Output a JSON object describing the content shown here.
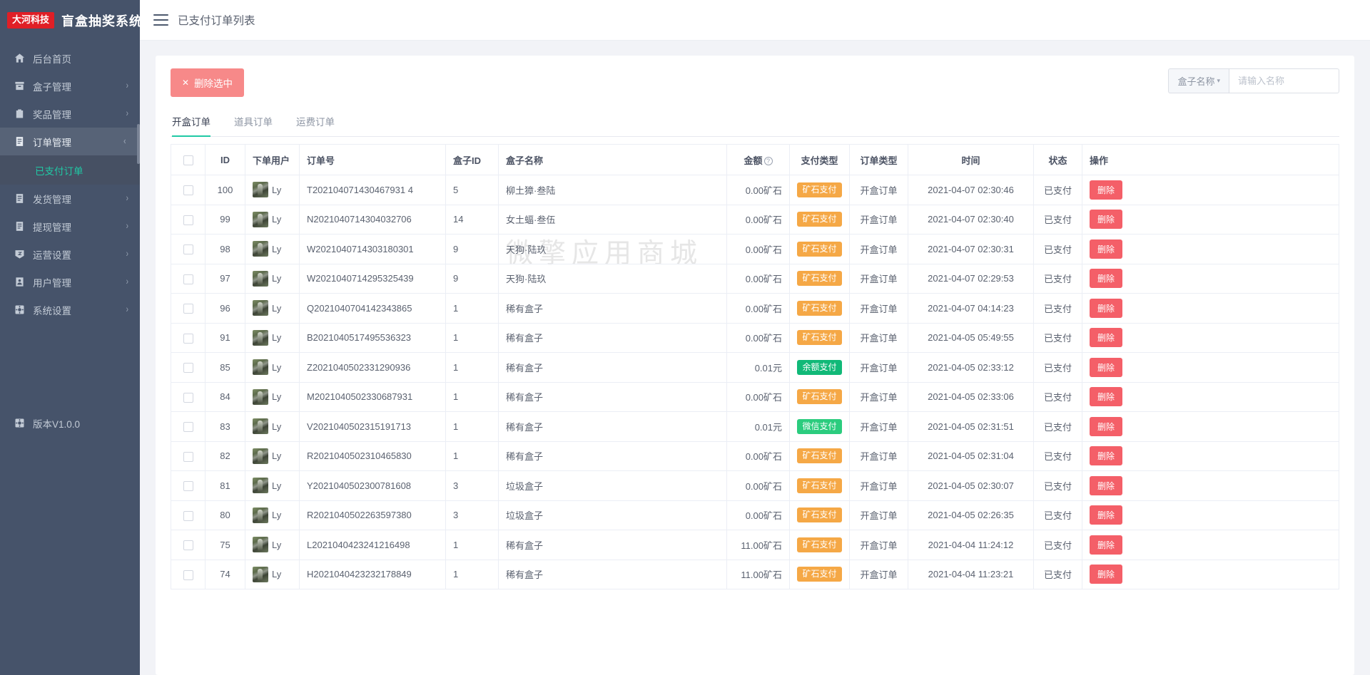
{
  "brand": {
    "logo_text": "大河科技",
    "title": "盲盒抽奖系统"
  },
  "sidebar": {
    "items": [
      {
        "label": "后台首页",
        "icon": "home-icon",
        "arrow": ""
      },
      {
        "label": "盒子管理",
        "icon": "box-icon",
        "arrow": "›"
      },
      {
        "label": "奖品管理",
        "icon": "gift-icon",
        "arrow": "›"
      },
      {
        "label": "订单管理",
        "icon": "order-icon",
        "arrow": "⌄",
        "expanded": true
      },
      {
        "label": "发货管理",
        "icon": "ship-icon",
        "arrow": "›"
      },
      {
        "label": "提现管理",
        "icon": "cash-icon",
        "arrow": "›"
      },
      {
        "label": "运营设置",
        "icon": "ops-icon",
        "arrow": "›"
      },
      {
        "label": "用户管理",
        "icon": "user-icon",
        "arrow": "›"
      },
      {
        "label": "系统设置",
        "icon": "gear-icon",
        "arrow": "›"
      }
    ],
    "submenu": [
      {
        "label": "已支付订单",
        "active": true
      }
    ],
    "version": {
      "label": "版本V1.0.0",
      "icon": "version-icon"
    }
  },
  "topbar": {
    "title": "已支付订单列表",
    "menu_icon": "hamburger-icon"
  },
  "toolbar": {
    "delete_selected_label": "删除选中",
    "delete_selected_icon": "close-x-icon",
    "search_prefix_label": "盒子名称",
    "search_prefix_caret": "▾",
    "search_placeholder": "请输入名称",
    "search_value": ""
  },
  "tabs": [
    {
      "label": "开盒订单",
      "active": true
    },
    {
      "label": "道具订单",
      "active": false
    },
    {
      "label": "运费订单",
      "active": false
    }
  ],
  "watermark": "微擎应用商城",
  "table": {
    "columns": [
      {
        "key": "checkbox",
        "label": ""
      },
      {
        "key": "id",
        "label": "ID"
      },
      {
        "key": "user",
        "label": "下单用户"
      },
      {
        "key": "order_no",
        "label": "订单号"
      },
      {
        "key": "box_id",
        "label": "盒子ID"
      },
      {
        "key": "box_name",
        "label": "盒子名称"
      },
      {
        "key": "amount",
        "label": "金额",
        "has_help_icon": true,
        "help_glyph": "?"
      },
      {
        "key": "pay_type",
        "label": "支付类型"
      },
      {
        "key": "order_type",
        "label": "订单类型"
      },
      {
        "key": "time",
        "label": "时间"
      },
      {
        "key": "status",
        "label": "状态"
      },
      {
        "key": "action",
        "label": "操作"
      }
    ],
    "action_label": "删除",
    "rows": [
      {
        "id": "100",
        "user": "Ly",
        "order_no": "T202104071430467931 4",
        "box_id": "5",
        "box_name": "柳土獐·叁陆",
        "amount": "0.00矿石",
        "pay_type": "矿石支付",
        "pay_class": "ore",
        "order_type": "开盒订单",
        "time": "2021-04-07 02:30:46",
        "status": "已支付"
      },
      {
        "id": "99",
        "user": "Ly",
        "order_no": "N2021040714304032706",
        "box_id": "14",
        "box_name": "女土蝠·叁伍",
        "amount": "0.00矿石",
        "pay_type": "矿石支付",
        "pay_class": "ore",
        "order_type": "开盒订单",
        "time": "2021-04-07 02:30:40",
        "status": "已支付"
      },
      {
        "id": "98",
        "user": "Ly",
        "order_no": "W2021040714303180301",
        "box_id": "9",
        "box_name": "天狗·陆玖",
        "amount": "0.00矿石",
        "pay_type": "矿石支付",
        "pay_class": "ore",
        "order_type": "开盒订单",
        "time": "2021-04-07 02:30:31",
        "status": "已支付"
      },
      {
        "id": "97",
        "user": "Ly",
        "order_no": "W2021040714295325439",
        "box_id": "9",
        "box_name": "天狗·陆玖",
        "amount": "0.00矿石",
        "pay_type": "矿石支付",
        "pay_class": "ore",
        "order_type": "开盒订单",
        "time": "2021-04-07 02:29:53",
        "status": "已支付"
      },
      {
        "id": "96",
        "user": "Ly",
        "order_no": "Q2021040704142343865",
        "box_id": "1",
        "box_name": "稀有盒子",
        "amount": "0.00矿石",
        "pay_type": "矿石支付",
        "pay_class": "ore",
        "order_type": "开盒订单",
        "time": "2021-04-07 04:14:23",
        "status": "已支付"
      },
      {
        "id": "91",
        "user": "Ly",
        "order_no": "B2021040517495536323",
        "box_id": "1",
        "box_name": "稀有盒子",
        "amount": "0.00矿石",
        "pay_type": "矿石支付",
        "pay_class": "ore",
        "order_type": "开盒订单",
        "time": "2021-04-05 05:49:55",
        "status": "已支付"
      },
      {
        "id": "85",
        "user": "Ly",
        "order_no": "Z2021040502331290936",
        "box_id": "1",
        "box_name": "稀有盒子",
        "amount": "0.01元",
        "pay_type": "余额支付",
        "pay_class": "balance",
        "order_type": "开盒订单",
        "time": "2021-04-05 02:33:12",
        "status": "已支付"
      },
      {
        "id": "84",
        "user": "Ly",
        "order_no": "M2021040502330687931",
        "box_id": "1",
        "box_name": "稀有盒子",
        "amount": "0.00矿石",
        "pay_type": "矿石支付",
        "pay_class": "ore",
        "order_type": "开盒订单",
        "time": "2021-04-05 02:33:06",
        "status": "已支付"
      },
      {
        "id": "83",
        "user": "Ly",
        "order_no": "V2021040502315191713",
        "box_id": "1",
        "box_name": "稀有盒子",
        "amount": "0.01元",
        "pay_type": "微信支付",
        "pay_class": "wechat",
        "order_type": "开盒订单",
        "time": "2021-04-05 02:31:51",
        "status": "已支付"
      },
      {
        "id": "82",
        "user": "Ly",
        "order_no": "R2021040502310465830",
        "box_id": "1",
        "box_name": "稀有盒子",
        "amount": "0.00矿石",
        "pay_type": "矿石支付",
        "pay_class": "ore",
        "order_type": "开盒订单",
        "time": "2021-04-05 02:31:04",
        "status": "已支付"
      },
      {
        "id": "81",
        "user": "Ly",
        "order_no": "Y2021040502300781608",
        "box_id": "3",
        "box_name": "垃圾盒子",
        "amount": "0.00矿石",
        "pay_type": "矿石支付",
        "pay_class": "ore",
        "order_type": "开盒订单",
        "time": "2021-04-05 02:30:07",
        "status": "已支付"
      },
      {
        "id": "80",
        "user": "Ly",
        "order_no": "R2021040502263597380",
        "box_id": "3",
        "box_name": "垃圾盒子",
        "amount": "0.00矿石",
        "pay_type": "矿石支付",
        "pay_class": "ore",
        "order_type": "开盒订单",
        "time": "2021-04-05 02:26:35",
        "status": "已支付"
      },
      {
        "id": "75",
        "user": "Ly",
        "order_no": "L2021040423241216498",
        "box_id": "1",
        "box_name": "稀有盒子",
        "amount": "11.00矿石",
        "pay_type": "矿石支付",
        "pay_class": "ore",
        "order_type": "开盒订单",
        "time": "2021-04-04 11:24:12",
        "status": "已支付"
      },
      {
        "id": "74",
        "user": "Ly",
        "order_no": "H2021040423232178849",
        "box_id": "1",
        "box_name": "稀有盒子",
        "amount": "11.00矿石",
        "pay_type": "矿石支付",
        "pay_class": "ore",
        "order_type": "开盒订单",
        "time": "2021-04-04 11:23:21",
        "status": "已支付"
      }
    ]
  },
  "colors": {
    "sidebar_bg": "#46536a",
    "accent_teal": "#20c9a5",
    "brand_red": "#e01f26",
    "danger": "#f45f68",
    "danger_light": "#f78989",
    "badge_ore": "#f5a846",
    "badge_balance": "#11b978",
    "badge_wechat": "#2bcc7e"
  }
}
